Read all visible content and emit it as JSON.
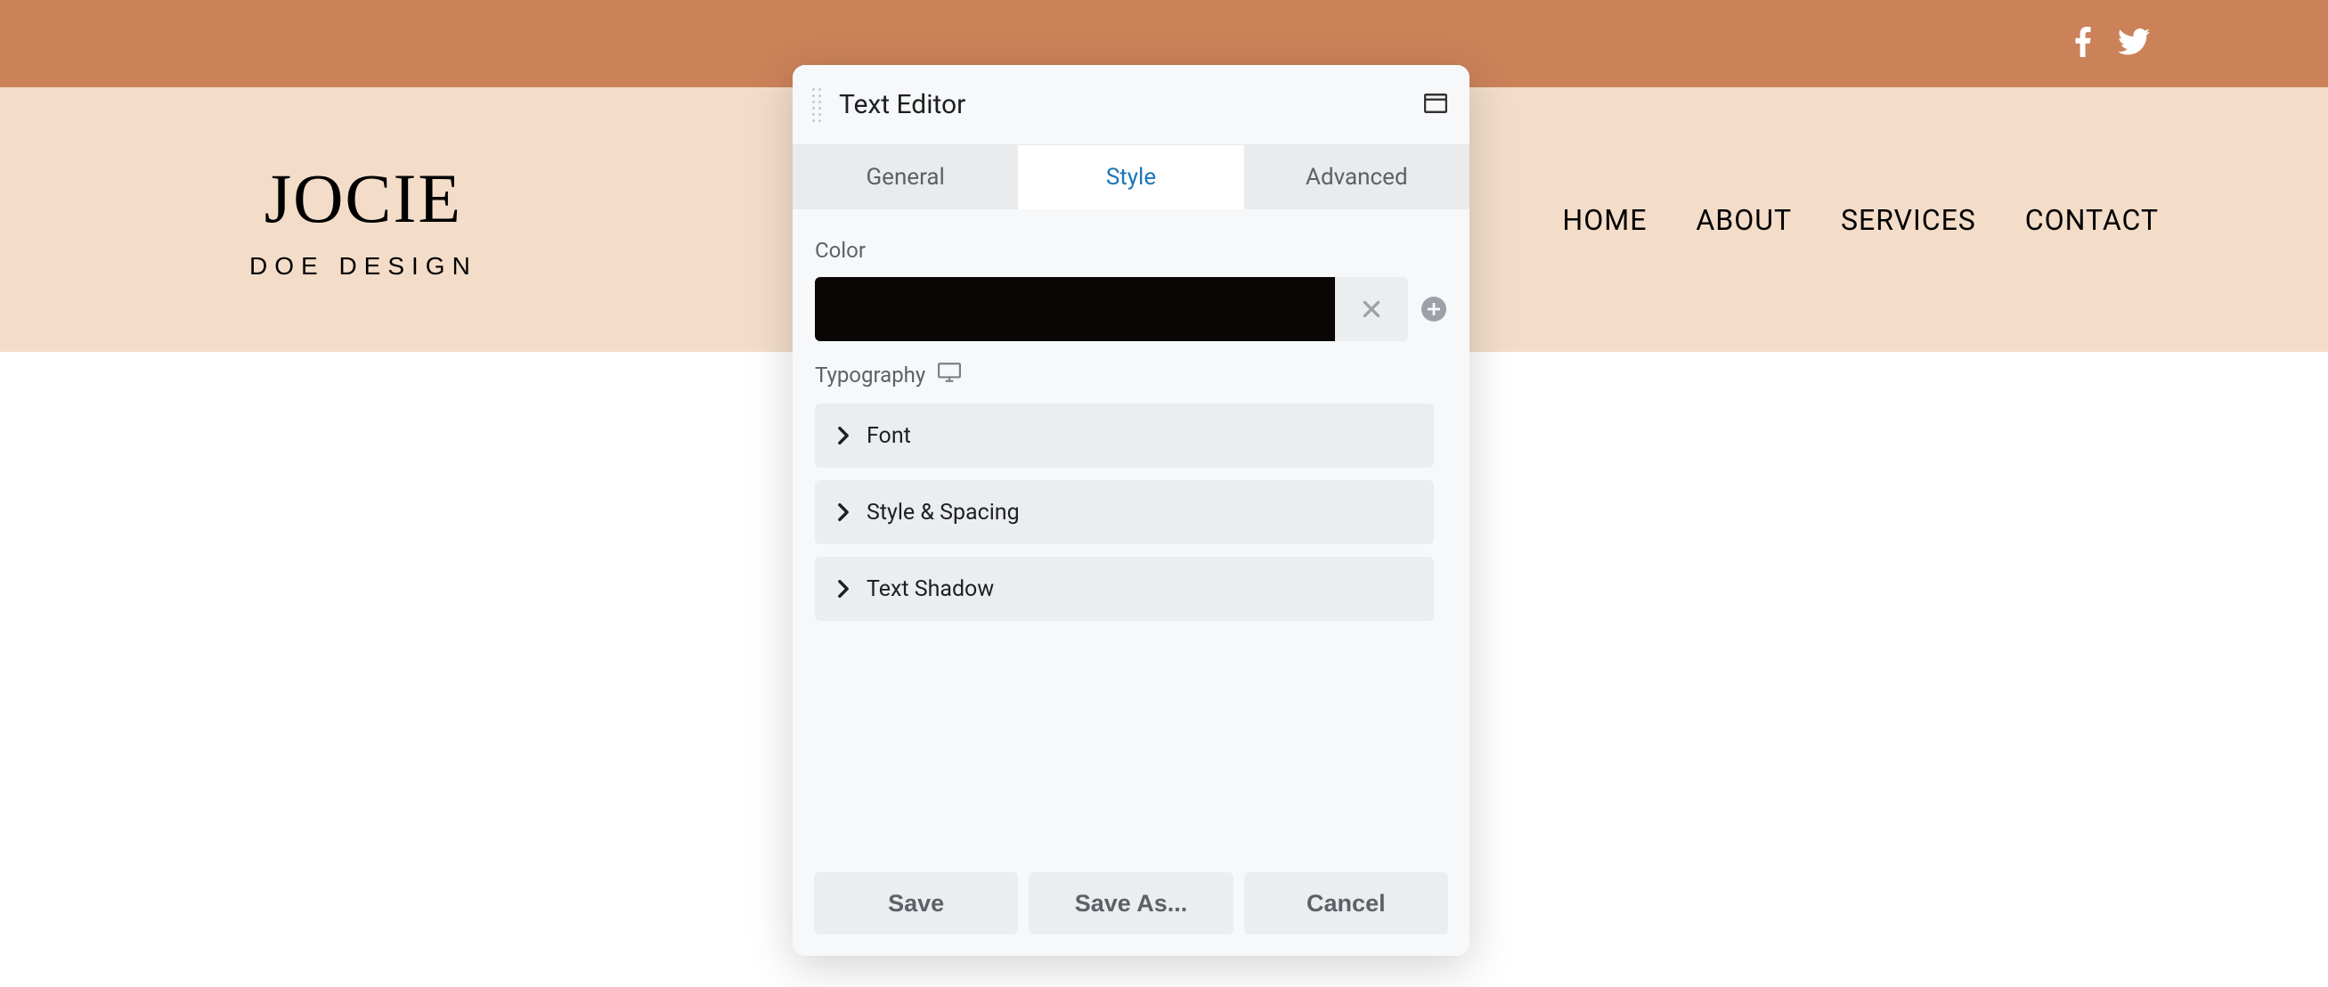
{
  "topBar": {
    "socialIcons": [
      "facebook",
      "twitter"
    ]
  },
  "navBar": {
    "logoMain": "JOCIE",
    "logoSub": "DOE DESIGN",
    "links": [
      "HOME",
      "ABOUT",
      "SERVICES",
      "CONTACT"
    ]
  },
  "editor": {
    "title": "Text Editor",
    "tabs": {
      "general": "General",
      "style": "Style",
      "advanced": "Advanced"
    },
    "sections": {
      "colorLabel": "Color",
      "colorValue": "#0a0606",
      "typographyLabel": "Typography",
      "accordion": {
        "font": "Font",
        "styleSpacing": "Style & Spacing",
        "textShadow": "Text Shadow"
      }
    },
    "footer": {
      "save": "Save",
      "saveAs": "Save As...",
      "cancel": "Cancel"
    }
  }
}
